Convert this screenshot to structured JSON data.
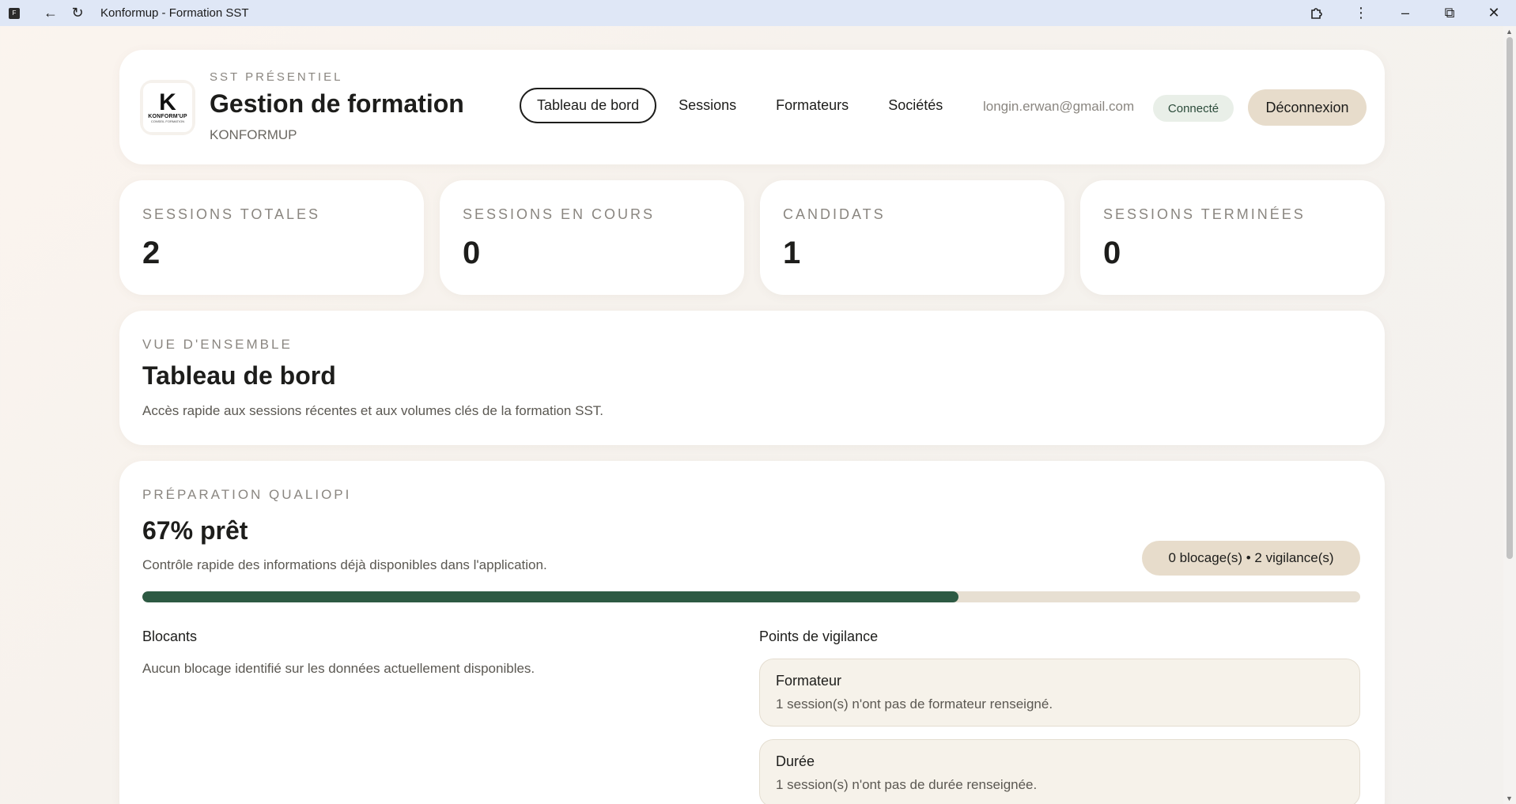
{
  "window": {
    "title": "Konformup - Formation SST"
  },
  "header": {
    "eyebrow": "SST PRÉSENTIEL",
    "title": "Gestion de formation",
    "company": "KONFORMUP",
    "logo": {
      "letter": "K",
      "brand": "KONFORM'UP",
      "tagline": "CONSEIL FORMATION"
    },
    "nav": [
      "Tableau de bord",
      "Sessions",
      "Formateurs",
      "Sociétés"
    ],
    "email": "longin.erwan@gmail.com",
    "status": "Connecté",
    "logout": "Déconnexion"
  },
  "stats": [
    {
      "label": "SESSIONS TOTALES",
      "value": "2"
    },
    {
      "label": "SESSIONS EN COURS",
      "value": "0"
    },
    {
      "label": "CANDIDATS",
      "value": "1"
    },
    {
      "label": "SESSIONS TERMINÉES",
      "value": "0"
    }
  ],
  "overview": {
    "eyebrow": "VUE D'ENSEMBLE",
    "title": "Tableau de bord",
    "description": "Accès rapide aux sessions récentes et aux volumes clés de la formation SST."
  },
  "qualiopi": {
    "eyebrow": "PRÉPARATION QUALIOPI",
    "title": "67% prêt",
    "description": "Contrôle rapide des informations déjà disponibles dans l'application.",
    "issues": "0 blocage(s) • 2 vigilance(s)",
    "progress": 0.67,
    "progress_color": "#2d5a43",
    "blockers_title": "Blocants",
    "blockers_text": "Aucun blocage identifié sur les données actuellement disponibles.",
    "vigilance_title": "Points de vigilance",
    "vigilance": [
      {
        "title": "Formateur",
        "text": "1 session(s) n'ont pas de formateur renseigné."
      },
      {
        "title": "Durée",
        "text": "1 session(s) n'ont pas de durée renseignée."
      }
    ]
  }
}
